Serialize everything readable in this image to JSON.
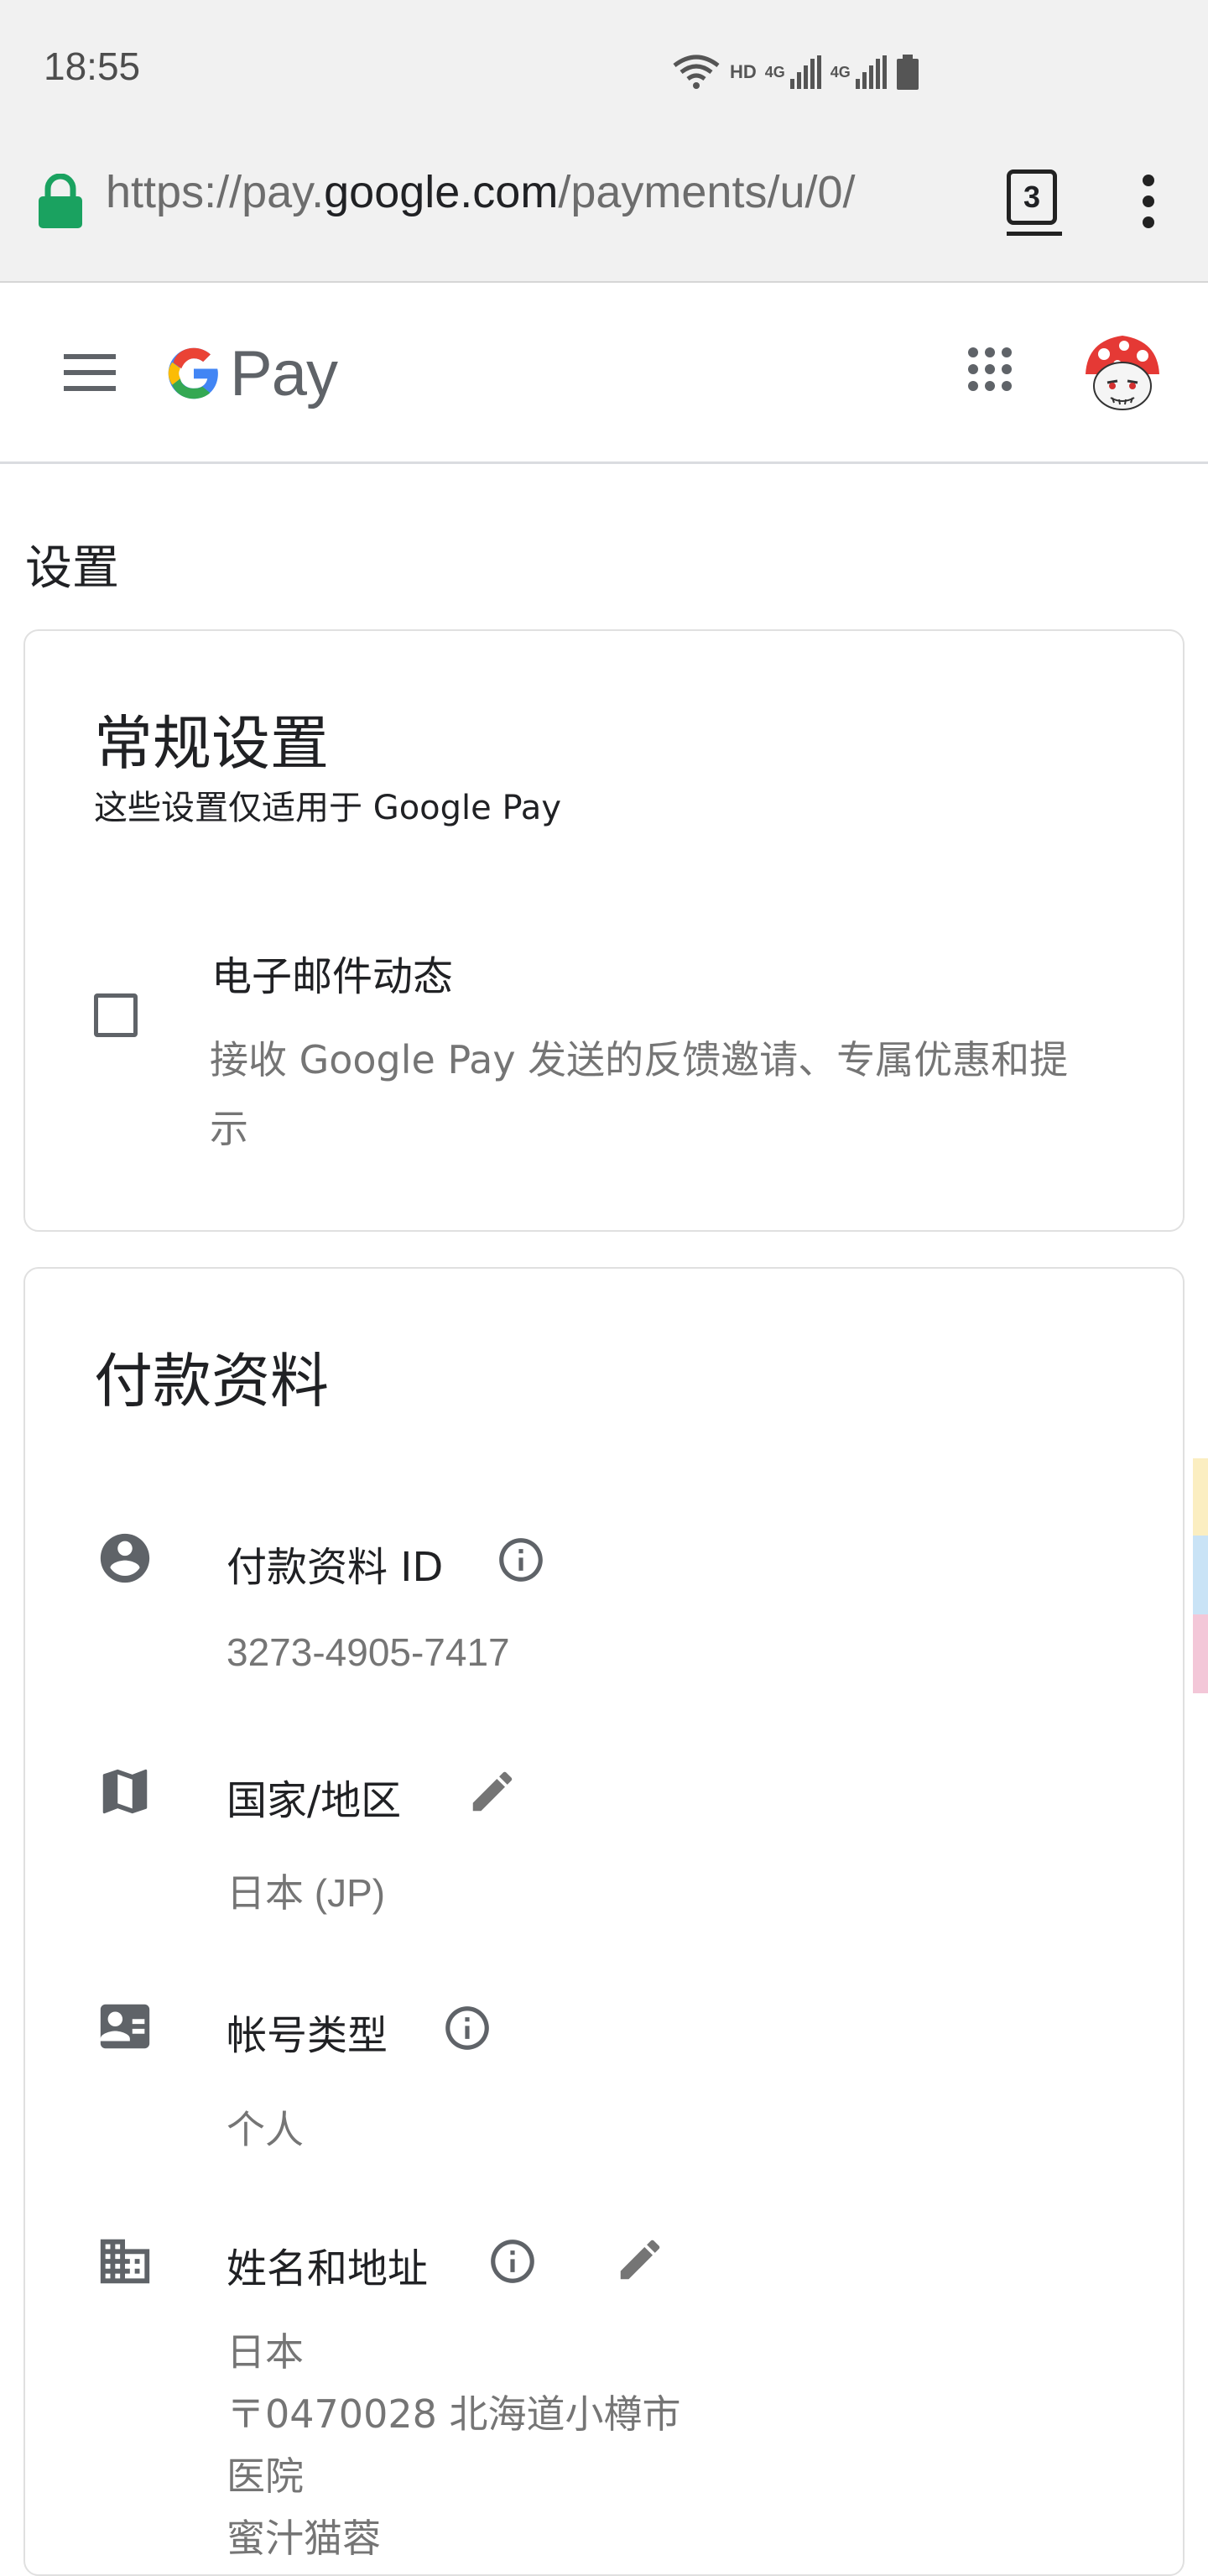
{
  "status_bar": {
    "time": "18:55",
    "hd_label": "HD",
    "network_1": "4G",
    "network_2": "4G"
  },
  "browser": {
    "url_prefix": "https://pay.",
    "url_domain": "google.com",
    "url_path": "/payments/u/0/",
    "tab_count": "3"
  },
  "app": {
    "logo_text": "Pay"
  },
  "page": {
    "title": "设置"
  },
  "general_settings": {
    "title": "常规设置",
    "subtitle": "这些设置仅适用于 Google Pay",
    "email_updates": {
      "label": "电子邮件动态",
      "description_line1": "接收 Google Pay 发送的反馈邀请、专属优惠和提",
      "description_line2": "示",
      "checked": false
    }
  },
  "payments_profile": {
    "title": "付款资料",
    "profile_id": {
      "label": "付款资料 ID",
      "value": "3273-4905-7417"
    },
    "country": {
      "label": "国家/地区",
      "value": "日本 (JP)"
    },
    "account_type": {
      "label": "帐号类型",
      "value": "个人"
    },
    "name_address": {
      "label": "姓名和地址",
      "lines": [
        "日本",
        "〒0470028 北海道小樽市",
        "医院",
        "蜜汁猫蓉"
      ]
    }
  },
  "colors": {
    "lock_green": "#1aa260",
    "icon_grey": "#5f6368",
    "text_secondary": "#757575",
    "strip_yellow": "#fbeec1",
    "strip_blue": "#c9e3f6",
    "strip_pink": "#f3c7d8"
  }
}
